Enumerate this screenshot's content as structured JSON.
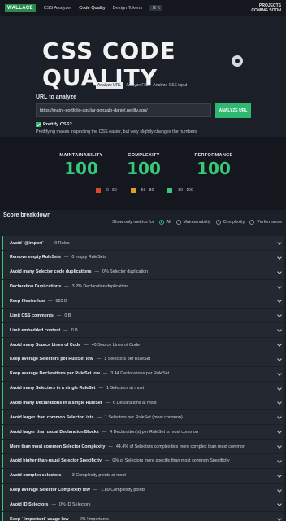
{
  "nav": {
    "logo": "WALLACE",
    "links": [
      "CSS Analyzer",
      "Code Quality",
      "Design Tokens"
    ],
    "shortcut": "⌘ K",
    "projects_line1": "PROJECTS",
    "projects_line2": "COMING SOON"
  },
  "hero": {
    "title": "CSS CODE QUALITY",
    "tabs": [
      "Analyze URL",
      "Analyze File",
      "Analyze CSS input"
    ],
    "url_label": "URL to analyze",
    "url_value": "https://main--portfolio-aguilar-gonzalo-daniel.netlify.app/",
    "analyze_label": "ANALYZE URL",
    "prettify_label": "Prettify CSS?",
    "prettify_note": "Prettifying makes inspecting the CSS easier, but very slightly changes the numbers."
  },
  "scores": {
    "maintainability": {
      "label": "MAINTAINABILITY",
      "value": "100"
    },
    "complexity": {
      "label": "COMPLEXITY",
      "value": "100"
    },
    "performance": {
      "label": "PERFORMANCE",
      "value": "100"
    },
    "legend": [
      {
        "label": "0 - 50",
        "color": "#e0452f"
      },
      {
        "label": "50 - 80",
        "color": "#e59a2a"
      },
      {
        "label": "80 - 100",
        "color": "#39c87a"
      }
    ]
  },
  "breakdown": {
    "title": "Score breakdown",
    "filter_label": "Show only metrics for",
    "filter_options": [
      "All",
      "Maintainability",
      "Complexity",
      "Performance"
    ],
    "rows": [
      {
        "name": "Avoid `@import`",
        "value": "0 Rules"
      },
      {
        "name": "Remove empty RuleSets",
        "value": "0 empty RuleSets"
      },
      {
        "name": "Avoid many Selector code duplications",
        "value": "0% Selector duplication"
      },
      {
        "name": "Declaration Duplications",
        "value": "3.2% Declaration duplication"
      },
      {
        "name": "Keep filesize low",
        "value": "883 B"
      },
      {
        "name": "Limit CSS comments",
        "value": "0 B"
      },
      {
        "name": "Limit embedded content",
        "value": "0 B"
      },
      {
        "name": "Avoid many Source Lines of Code",
        "value": "40 Source Lines of Code"
      },
      {
        "name": "Keep average Selectors per RuleSet low",
        "value": "1 Selectors per RuleSet"
      },
      {
        "name": "Keep average Declarations per RuleSet low",
        "value": "3.44 Declarations per RuleSet"
      },
      {
        "name": "Avoid many Selectors in a single RuleSet",
        "value": "1 Selectors at most"
      },
      {
        "name": "Avoid many Declarations in a single RuleSet",
        "value": "6 Declarations at most"
      },
      {
        "name": "Avoid larger than common SelectorLists",
        "value": "1 Selectors per RuleSet (most common)"
      },
      {
        "name": "Avoid larger than usual Declaration Blocks",
        "value": "4 Declaration(s) per RuleSet is most common"
      },
      {
        "name": "More than most common Selector Complexity",
        "value": "44.4% of Selectors complexities more complex than most common"
      },
      {
        "name": "Avoid higher-than-usual Selector Specificity",
        "value": "0% of Selectors more specific than most common Specificity"
      },
      {
        "name": "Avoid complex selectors",
        "value": "3 Complexity points at most"
      },
      {
        "name": "Keep average Selector Complexity low",
        "value": "1.89 Complexity points"
      },
      {
        "name": "Avoid ID Selectors",
        "value": "0% ID Selectors"
      },
      {
        "name": "Keep `!important` usage low",
        "value": "0% !importants"
      }
    ]
  }
}
